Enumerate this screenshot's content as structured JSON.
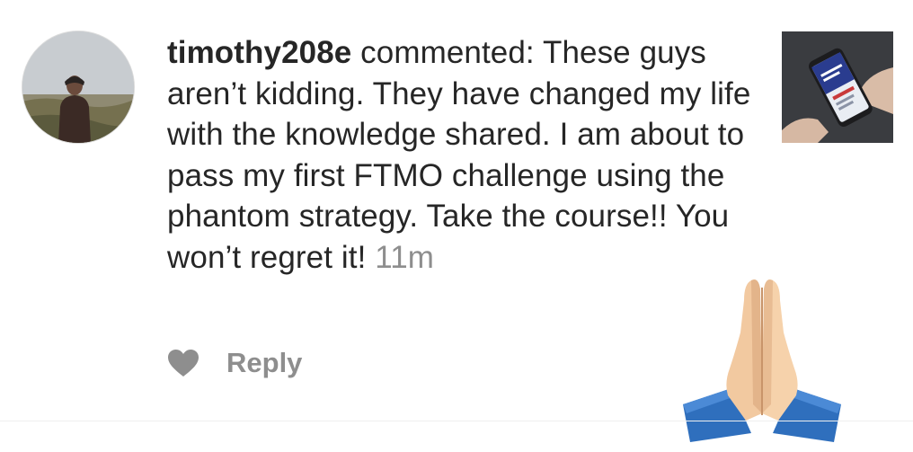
{
  "comment": {
    "username": "timothy208e",
    "verb": "commented:",
    "text": "These guys aren’t kidding. They have changed my life with the knowledge shared. I am about to pass my first FTMO challenge using the phantom strategy. Take the course!! You won’t regret it!",
    "time": "11m"
  },
  "actions": {
    "like_icon": "heart-icon",
    "reply_label": "Reply"
  },
  "icons": {
    "avatar": "profile-photo",
    "thumbnail": "post-thumbnail-phone",
    "emoji": "folded-hands-emoji"
  },
  "colors": {
    "text": "#262626",
    "muted": "#8e8e8e",
    "heart": "#8e8e8e"
  }
}
